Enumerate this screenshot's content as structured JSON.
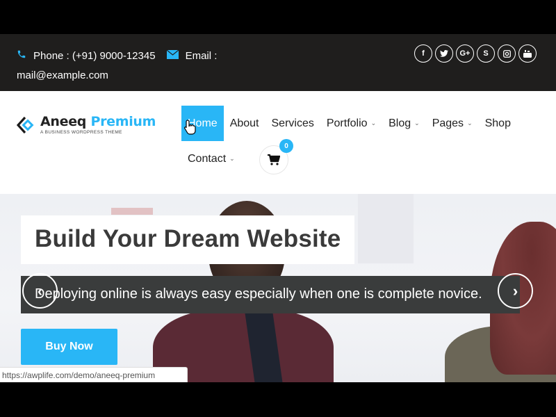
{
  "topbar": {
    "phone_icon": "phone-icon",
    "phone_label": "Phone : (+91) 9000-12345",
    "email_icon": "envelope-icon",
    "email_label": "Email :",
    "email_value": "mail@example.com",
    "social": [
      {
        "name": "facebook",
        "glyph": "f"
      },
      {
        "name": "twitter",
        "glyph": "t"
      },
      {
        "name": "google-plus",
        "glyph": "G+"
      },
      {
        "name": "skype",
        "glyph": "S"
      },
      {
        "name": "instagram",
        "glyph": "◘"
      },
      {
        "name": "youtube",
        "glyph": "▶"
      }
    ]
  },
  "brand": {
    "name_primary": "Aneeq",
    "name_accent": "Premium",
    "tagline": "A BUSINESS WORDPRESS THEME",
    "accent_color": "#29b6f6"
  },
  "nav": {
    "items": [
      {
        "label": "Home",
        "active": true,
        "dropdown": false
      },
      {
        "label": "About",
        "active": false,
        "dropdown": false
      },
      {
        "label": "Services",
        "active": false,
        "dropdown": false
      },
      {
        "label": "Portfolio",
        "active": false,
        "dropdown": true
      },
      {
        "label": "Blog",
        "active": false,
        "dropdown": true
      },
      {
        "label": "Pages",
        "active": false,
        "dropdown": true
      },
      {
        "label": "Shop",
        "active": false,
        "dropdown": false
      }
    ],
    "contact": {
      "label": "Contact",
      "dropdown": true
    },
    "chevron": "⌄",
    "cart_count": "0"
  },
  "hero": {
    "title": "Build Your Dream Website",
    "subtitle": "Deploying online is always easy especially when one is complete novice.",
    "cta_label": "Buy Now",
    "prev_glyph": "‹",
    "next_glyph": "›"
  },
  "status_bar": {
    "url": "https://awplife.com/demo/aneeq-premium"
  }
}
